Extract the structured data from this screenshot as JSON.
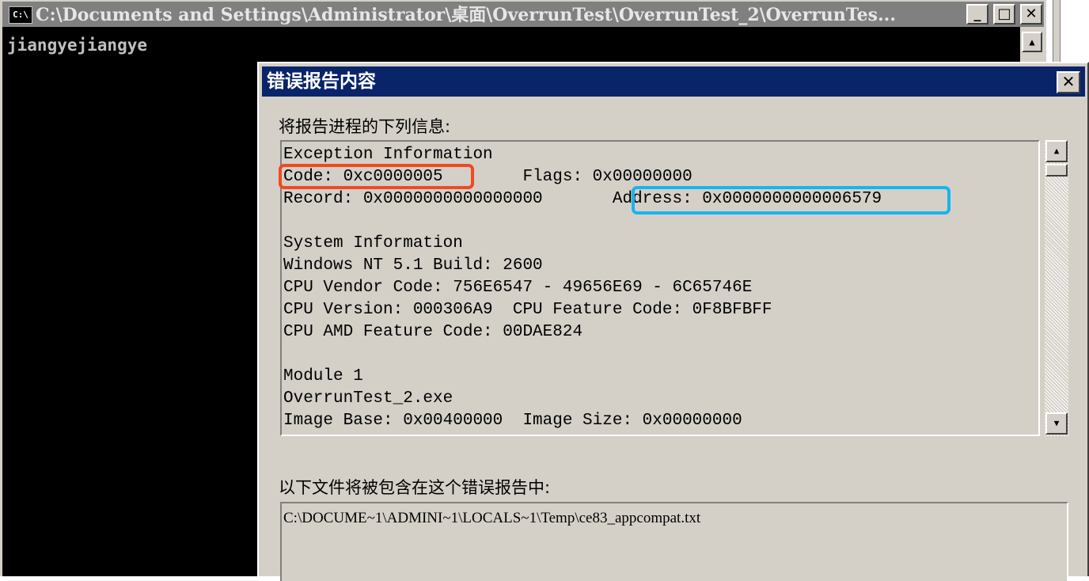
{
  "console": {
    "icon_label": "C:\\",
    "title": "C:\\Documents and Settings\\Administrator\\桌面\\OverrunTest\\OverrunTest_2\\OverrunTes...",
    "minimize_glyph": "_",
    "maximize_glyph": "□",
    "close_glyph": "✕",
    "output_line": "jiangyejiangye",
    "scroll_up_glyph": "▲"
  },
  "dialog": {
    "title": "错误报告内容",
    "close_glyph": "✕",
    "report_label": "将报告进程的下列信息:",
    "report_lines": [
      "Exception Information",
      "Code: 0xc0000005        Flags: 0x00000000",
      "Record: 0x0000000000000000       Address: 0x0000000000006579",
      "",
      "System Information",
      "Windows NT 5.1 Build: 2600",
      "CPU Vendor Code: 756E6547 - 49656E69 - 6C65746E",
      "CPU Version: 000306A9  CPU Feature Code: 0F8BFBFF",
      "CPU AMD Feature Code: 00DAE824",
      "",
      "Module 1",
      "OverrunTest_2.exe",
      "Image Base: 0x00400000  Image Size: 0x00000000"
    ],
    "scroll_up_glyph": "▲",
    "scroll_down_glyph": "▼",
    "files_label": "以下文件将被包含在这个错误报告中:",
    "files": [
      "C:\\DOCUME~1\\ADMINI~1\\LOCALS~1\\Temp\\ce83_appcompat.txt"
    ]
  },
  "annotations": {
    "code_highlight_color": "#f04a23",
    "address_highlight_color": "#1ab4ec"
  }
}
